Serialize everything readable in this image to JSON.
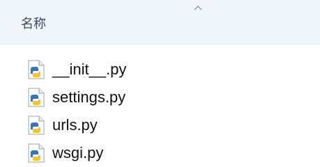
{
  "header": {
    "column_name": "名称",
    "sort_indicator_icon": "chevron-up-icon"
  },
  "files": [
    {
      "name": "__init__.py",
      "icon": "python-file-icon"
    },
    {
      "name": "settings.py",
      "icon": "python-file-icon"
    },
    {
      "name": "urls.py",
      "icon": "python-file-icon"
    },
    {
      "name": "wsgi.py",
      "icon": "python-file-icon"
    }
  ],
  "colors": {
    "header_bg": "#eff5fb",
    "header_text": "#3a4a5e",
    "file_text": "#111111",
    "python_blue": "#3b73b1",
    "python_yellow": "#f2c42c"
  }
}
